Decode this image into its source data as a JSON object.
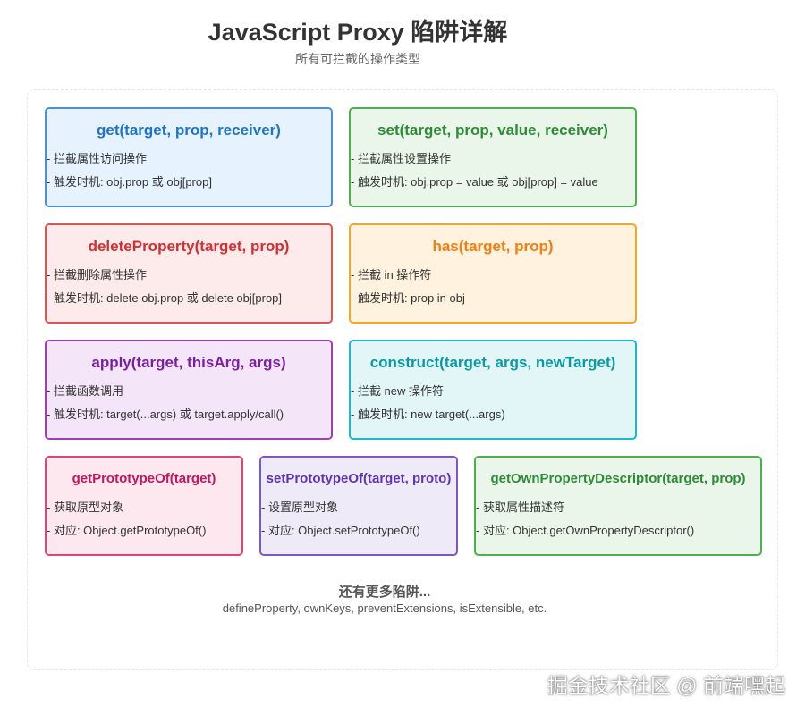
{
  "header": {
    "title": "JavaScript Proxy 陷阱详解",
    "subtitle": "所有可拦截的操作类型"
  },
  "traps": [
    {
      "name": "get(target, prop, receiver)",
      "desc": "- 拦截属性访问操作",
      "trigger": "- 触发时机: obj.prop 或 obj[prop]",
      "color": "#4a90d9"
    },
    {
      "name": "set(target, prop, value, receiver)",
      "desc": "- 拦截属性设置操作",
      "trigger": "- 触发时机: obj.prop = value 或 obj[prop] = value",
      "color": "#4caf50"
    },
    {
      "name": "deleteProperty(target, prop)",
      "desc": "- 拦截删除属性操作",
      "trigger": "- 触发时机: delete obj.prop 或 delete obj[prop]",
      "color": "#e05252"
    },
    {
      "name": "has(target, prop)",
      "desc": "- 拦截 in 操作符",
      "trigger": "- 触发时机: prop in obj",
      "color": "#f5a623"
    },
    {
      "name": "apply(target, thisArg, args)",
      "desc": "- 拦截函数调用",
      "trigger": "- 触发时机: target(...args) 或 target.apply/call()",
      "color": "#9c3fb4"
    },
    {
      "name": "construct(target, args, newTarget)",
      "desc": "- 拦截 new 操作符",
      "trigger": "- 触发时机: new target(...args)",
      "color": "#1fb8c4"
    },
    {
      "name": "getPrototypeOf(target)",
      "desc": "- 获取原型对象",
      "trigger": "- 对应: Object.getPrototypeOf()",
      "color": "#e0427a"
    },
    {
      "name": "setPrototypeOf(target, proto)",
      "desc": "- 设置原型对象",
      "trigger": "- 对应: Object.setPrototypeOf()",
      "color": "#7e57c2"
    },
    {
      "name": "getOwnPropertyDescriptor(target, prop)",
      "desc": "- 获取属性描述符",
      "trigger": "- 对应: Object.getOwnPropertyDescriptor()",
      "color": "#4caf50"
    }
  ],
  "more": {
    "title": "还有更多陷阱...",
    "list": "defineProperty, ownKeys, preventExtensions, isExtensible, etc."
  },
  "watermark": "掘金技术社区 @ 前端嘿起"
}
